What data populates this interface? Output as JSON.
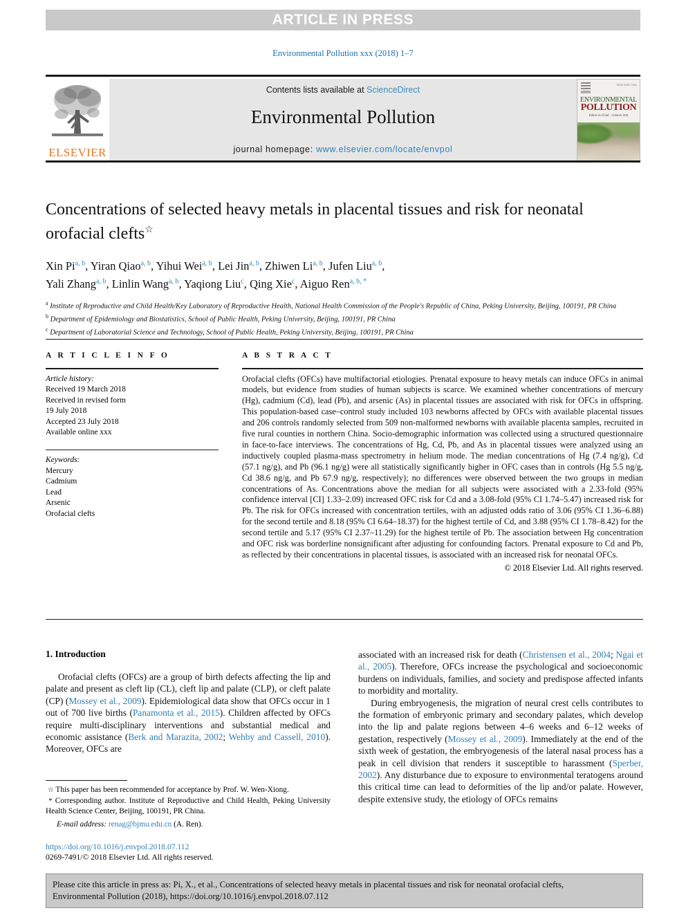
{
  "banner": {
    "text": "ARTICLE IN PRESS"
  },
  "running_head": "Environmental Pollution xxx (2018) 1–7",
  "masthead": {
    "contents_prefix": "Contents lists available at ",
    "sciencedirect": "ScienceDirect",
    "journal_title": "Environmental Pollution",
    "homepage_label": "journal homepage: ",
    "homepage_url": "www.elsevier.com/locate/envpol",
    "publisher": "ELSEVIER",
    "cover": {
      "line1": "ENVIRONMENTAL",
      "line2": "POLLUTION",
      "issn": "ISSN 0269-7491",
      "subtitle": "Editor-in-Chief  ·  Volume 000"
    }
  },
  "article": {
    "title": "Concentrations of selected heavy metals in placental tissues and risk for neonatal orofacial clefts",
    "title_mark": "☆",
    "authors": [
      {
        "name": "Xin Pi",
        "marks": "a, b",
        "sep": ", "
      },
      {
        "name": "Yiran Qiao",
        "marks": "a, b",
        "sep": ", "
      },
      {
        "name": "Yihui Wei",
        "marks": "a, b",
        "sep": ", "
      },
      {
        "name": "Lei Jin",
        "marks": "a, b",
        "sep": ", "
      },
      {
        "name": "Zhiwen Li",
        "marks": "a, b",
        "sep": ", "
      },
      {
        "name": "Jufen Liu",
        "marks": "a, b",
        "sep": ","
      },
      {
        "name": "Yali Zhang",
        "marks": "a, b",
        "sep": ", "
      },
      {
        "name": "Linlin Wang",
        "marks": "a, b",
        "sep": ", "
      },
      {
        "name": "Yaqiong Liu",
        "marks": "c",
        "sep": ", "
      },
      {
        "name": "Qing Xie",
        "marks": "c",
        "sep": ", "
      },
      {
        "name": "Aiguo Ren",
        "marks": "a, b, *",
        "sep": ""
      }
    ],
    "affiliations": [
      {
        "mark": "a",
        "text": "Institute of Reproductive and Child Health/Key Laboratory of Reproductive Health, National Health Commission of the People's Republic of China, Peking University, Beijing, 100191, PR China"
      },
      {
        "mark": "b",
        "text": "Department of Epidemiology and Biostatistics, School of Public Health, Peking University, Beijing, 100191, PR China"
      },
      {
        "mark": "c",
        "text": "Department of Laboratorial Science and Technology, School of Public Health, Peking University, Beijing, 100191, PR China"
      }
    ]
  },
  "article_info": {
    "heading": "A R T I C L E  I N F O",
    "history_label": "Article history:",
    "history": [
      "Received 19 March 2018",
      "Received in revised form",
      "19 July 2018",
      "Accepted 23 July 2018",
      "Available online xxx"
    ],
    "keywords_label": "Keywords:",
    "keywords": [
      "Mercury",
      "Cadmium",
      "Lead",
      "Arsenic",
      "Orofacial clefts"
    ]
  },
  "abstract": {
    "heading": "A B S T R A C T",
    "text": "Orofacial clefts (OFCs) have multifactorial etiologies. Prenatal exposure to heavy metals can induce OFCs in animal models, but evidence from studies of human subjects is scarce. We examined whether concentrations of mercury (Hg), cadmium (Cd), lead (Pb), and arsenic (As) in placental tissues are associated with risk for OFCs in offspring. This population-based case–control study included 103 newborns affected by OFCs with available placental tissues and 206 controls randomly selected from 509 non-malformed newborns with available placenta samples, recruited in five rural counties in northern China. Socio-demographic information was collected using a structured questionnaire in face-to-face interviews. The concentrations of Hg, Cd, Pb, and As in placental tissues were analyzed using an inductively coupled plasma-mass spectrometry in helium mode. The median concentrations of Hg (7.4 ng/g), Cd (57.1 ng/g), and Pb (96.1 ng/g) were all statistically significantly higher in OFC cases than in controls (Hg 5.5 ng/g, Cd 38.6 ng/g, and Pb 67.9 ng/g, respectively); no differences were observed between the two groups in median concentrations of As. Concentrations above the median for all subjects were associated with a 2.33-fold (95% confidence interval [CI] 1.33–2.09) increased OFC risk for Cd and a 3.08-fold (95% CI 1.74–5.47) increased risk for Pb. The risk for OFCs increased with concentration tertiles, with an adjusted odds ratio of 3.06 (95% CI 1.36–6.88) for the second tertile and 8.18 (95% CI 6.64–18.37) for the highest tertile of Cd, and 3.88 (95% CI 1.78–8.42) for the second tertile and 5.17 (95% CI 2.37–11.29) for the highest tertile of Pb. The association between Hg concentration and OFC risk was borderline nonsignificant after adjusting for confounding factors. Prenatal exposure to Cd and Pb, as reflected by their concentrations in placental tissues, is associated with an increased risk for neonatal OFCs.",
    "copyright": "© 2018 Elsevier Ltd. All rights reserved."
  },
  "body": {
    "section_heading": "1. Introduction",
    "left_paragraph_1": {
      "seg1": "Orofacial clefts (OFCs) are a group of birth defects affecting the lip and palate and present as cleft lip (CL), cleft lip and palate (CLP), or cleft palate (CP) (",
      "ref1": "Mossey et al., 2009",
      "seg2": "). Epidemiological data show that OFCs occur in 1 out of 700 live births (",
      "ref2": "Panamonta et al., 2015",
      "seg3": "). Children affected by OFCs require multi-disciplinary interventions and substantial medical and economic assistance (",
      "ref3": "Berk and Marazita, 2002",
      "seg4": "; ",
      "ref4": "Wehby and Cassell, 2010",
      "seg5": "). Moreover, OFCs are"
    },
    "right_paragraph_1": {
      "seg1": "associated with an increased risk for death (",
      "ref1": "Christensen et al., 2004",
      "seg2": "; ",
      "ref2": "Ngai et al., 2005",
      "seg3": "). Therefore, OFCs increase the psychological and socioeconomic burdens on individuals, families, and society and predispose affected infants to morbidity and mortality."
    },
    "right_paragraph_2": {
      "seg1": "During embryogenesis, the migration of neural crest cells contributes to the formation of embryonic primary and secondary palates, which develop into the lip and palate regions between 4–6 weeks and 6–12 weeks of gestation, respectively (",
      "ref1": "Mossey et al., 2009",
      "seg2": "). Immediately at the end of the sixth week of gestation, the embryogenesis of the lateral nasal process has a peak in cell division that renders it susceptible to harassment (",
      "ref2": "Sperber, 2002",
      "seg3": "). Any disturbance due to exposure to environmental teratogens around this critical time can lead to deformities of the lip and/or palate. However, despite extensive study, the etiology of OFCs remains"
    }
  },
  "footnotes": {
    "star_symbol": "☆",
    "star_text": "This paper has been recommended for acceptance by Prof. W. Wen-Xiong.",
    "corr_symbol": "*",
    "corr_text": "Corresponding author. Institute of Reproductive and Child Health, Peking University Health Science Center, Beijing, 100191, PR China.",
    "email_label": "E-mail address:",
    "email": "renag@bjmu.edu.cn",
    "email_owner": "(A. Ren)."
  },
  "doi_block": {
    "doi_url": "https://doi.org/10.1016/j.envpol.2018.07.112",
    "issn_line": "0269-7491/© 2018 Elsevier Ltd. All rights reserved."
  },
  "cite_box": {
    "line1": "Please cite this article in press as: Pi, X., et al., Concentrations of selected heavy metals in placental tissues and risk for neonatal orofacial clefts,",
    "line2": "Environmental Pollution (2018), https://doi.org/10.1016/j.envpol.2018.07.112"
  },
  "colors": {
    "link_blue": "#2f7fb5",
    "banner_gray": "#c9c9c9",
    "band_gray": "#e6e6e6",
    "elsevier_orange": "#e87722"
  }
}
